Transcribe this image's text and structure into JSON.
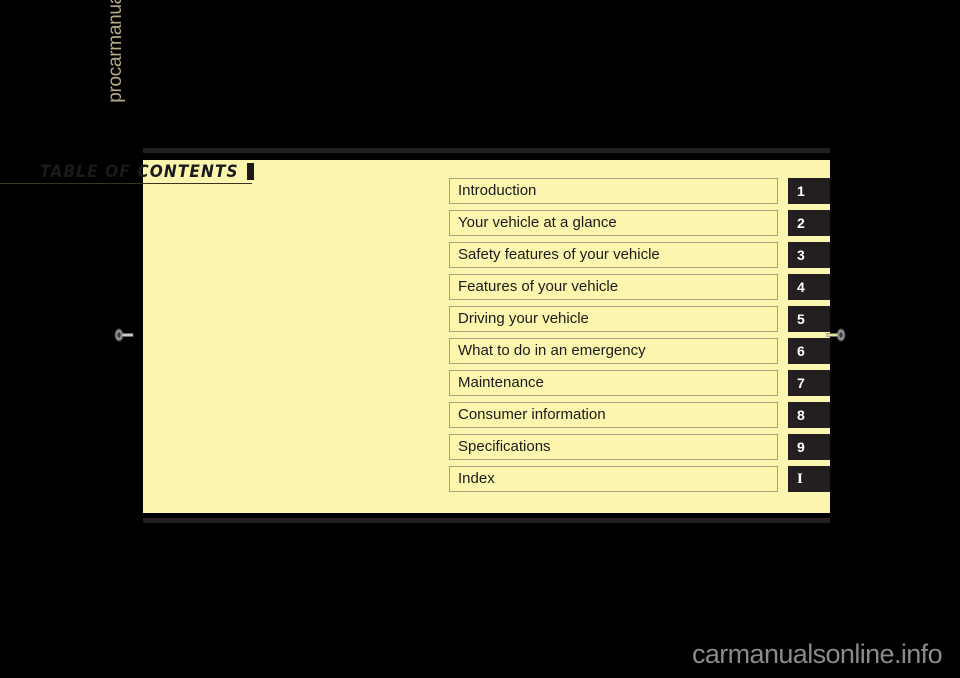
{
  "page": {
    "background_color": "#000000",
    "sheet_color": "#fcf5ae",
    "rule_color": "#231f20",
    "tab_color": "#231f20",
    "tab_text_color": "#ffffff"
  },
  "title": {
    "text": "TABLE  OF  CONTENTS",
    "marker": ""
  },
  "watermarks": {
    "left": "procarmanuals.com",
    "bottom_right": "carmanualsonline.info"
  },
  "contents": [
    {
      "label": "Introduction",
      "tab": "1",
      "serif": false
    },
    {
      "label": "Your vehicle at a glance",
      "tab": "2",
      "serif": false
    },
    {
      "label": "Safety features of your vehicle",
      "tab": "3",
      "serif": false
    },
    {
      "label": "Features of your vehicle",
      "tab": "4",
      "serif": false
    },
    {
      "label": "Driving your vehicle",
      "tab": "5",
      "serif": false
    },
    {
      "label": "What to do in an emergency",
      "tab": "6",
      "serif": false
    },
    {
      "label": "Maintenance",
      "tab": "7",
      "serif": false
    },
    {
      "label": "Consumer information",
      "tab": "8",
      "serif": false
    },
    {
      "label": "Specifications",
      "tab": "9",
      "serif": false
    },
    {
      "label": "Index",
      "tab": "I",
      "serif": true
    }
  ]
}
